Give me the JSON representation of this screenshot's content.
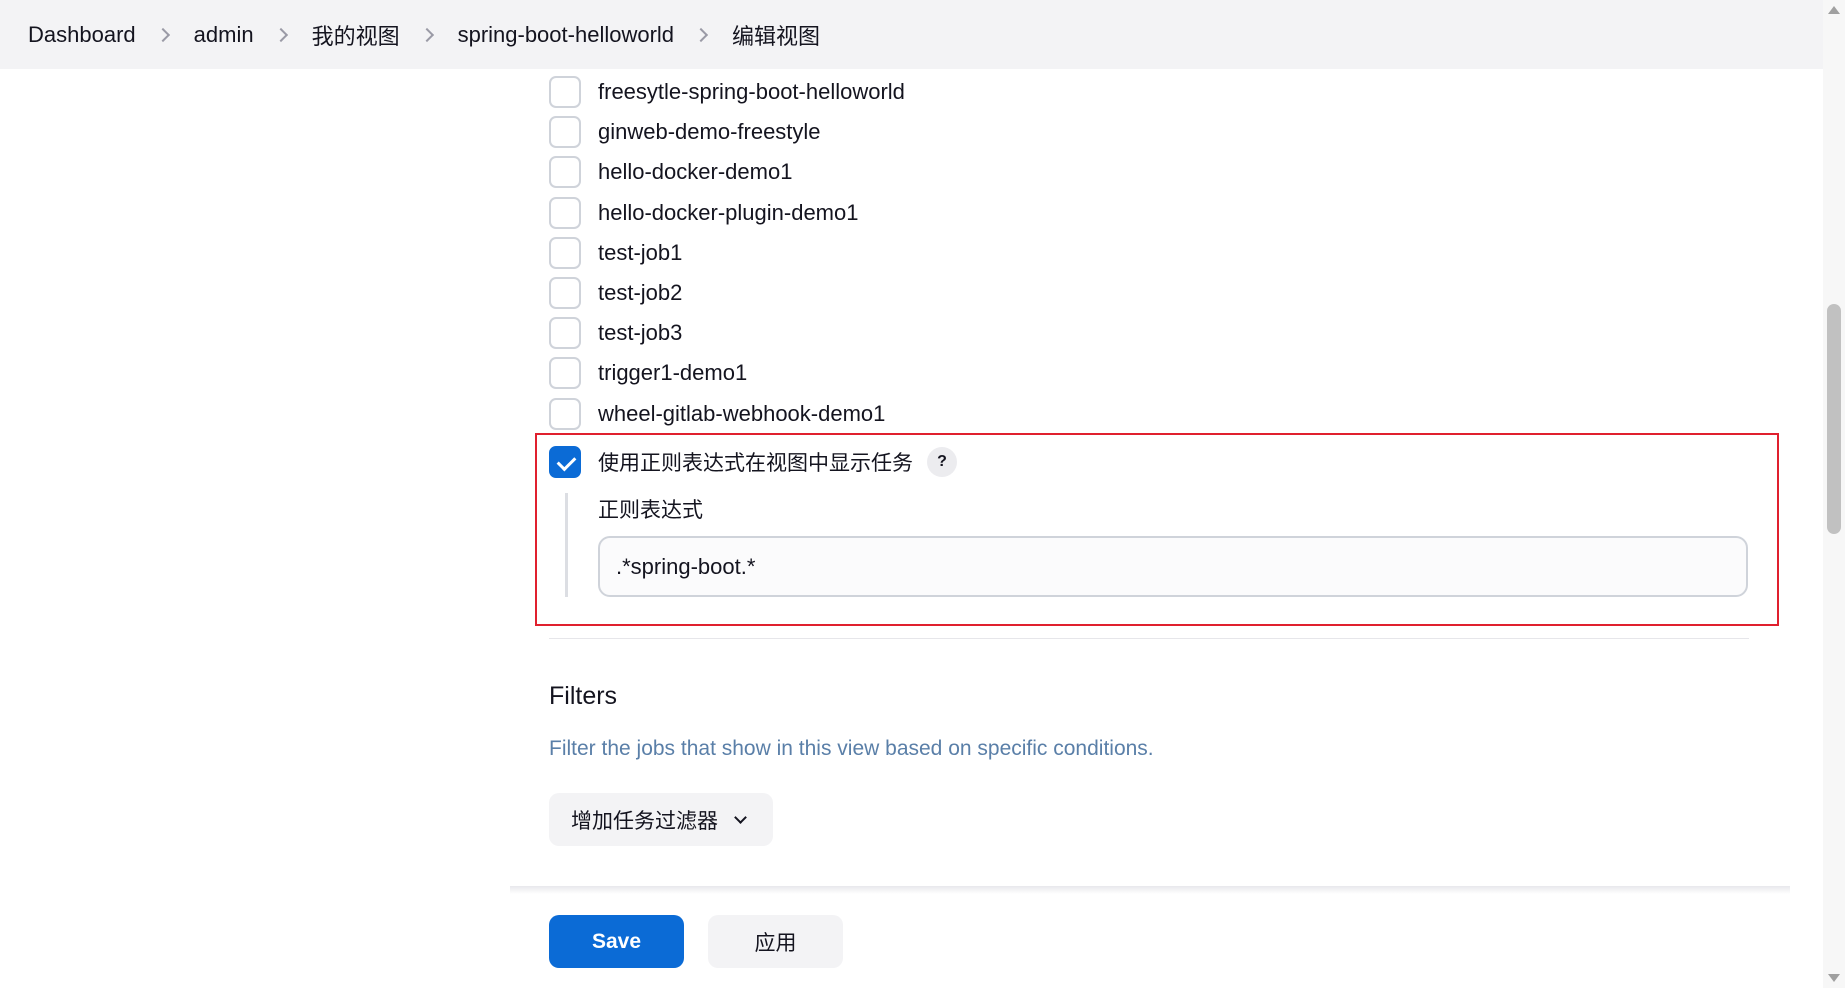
{
  "breadcrumb": {
    "items": [
      "Dashboard",
      "admin",
      "我的视图",
      "spring-boot-helloworld",
      "编辑视图"
    ]
  },
  "jobs": [
    {
      "name": "freesytle-spring-boot-helloworld",
      "checked": false
    },
    {
      "name": "ginweb-demo-freestyle",
      "checked": false
    },
    {
      "name": "hello-docker-demo1",
      "checked": false
    },
    {
      "name": "hello-docker-plugin-demo1",
      "checked": false
    },
    {
      "name": "test-job1",
      "checked": false
    },
    {
      "name": "test-job2",
      "checked": false
    },
    {
      "name": "test-job3",
      "checked": false
    },
    {
      "name": "trigger1-demo1",
      "checked": false
    },
    {
      "name": "wheel-gitlab-webhook-demo1",
      "checked": false
    }
  ],
  "regex": {
    "checkbox_label": "使用正则表达式在视图中显示任务",
    "checked": true,
    "help_icon": "?",
    "field_label": "正则表达式",
    "value": ".*spring-boot.*"
  },
  "filters": {
    "title": "Filters",
    "description": "Filter the jobs that show in this view based on specific conditions.",
    "add_button_label": "增加任务过滤器"
  },
  "actions": {
    "save_label": "Save",
    "apply_label": "应用"
  },
  "colors": {
    "primary": "#0b6bd6",
    "highlight_border": "#e0202e",
    "description_text": "#5a7fa8"
  }
}
